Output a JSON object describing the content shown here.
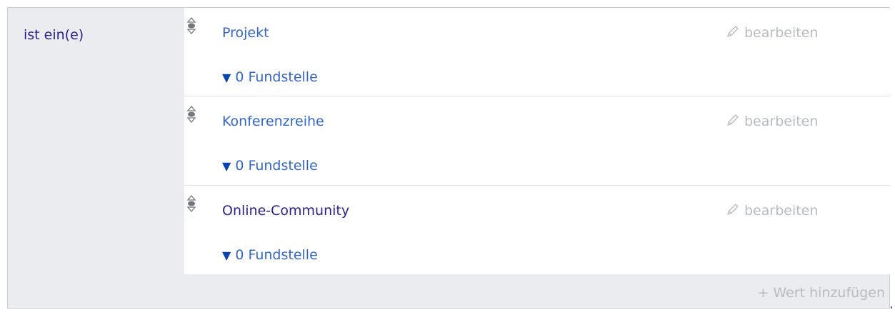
{
  "property": {
    "label": "ist ein(e)"
  },
  "statements": [
    {
      "value": "Projekt",
      "edit_label": "bearbeiten",
      "references_label": "0 Fundstelle",
      "references_toggle_glyph": "▼",
      "rank_icon": "normal-rank-icon"
    },
    {
      "value": "Konferenzreihe",
      "edit_label": "bearbeiten",
      "references_label": "0 Fundstelle",
      "references_toggle_glyph": "▼",
      "rank_icon": "normal-rank-icon"
    },
    {
      "value": "Online-Community",
      "edit_label": "bearbeiten",
      "references_label": "0 Fundstelle",
      "references_toggle_glyph": "▼",
      "rank_icon": "normal-rank-icon"
    }
  ],
  "add_value_label": "+ Wert hinzufügen",
  "colors": {
    "link": "#3366cc",
    "visited_link": "#2a1f8f",
    "disabled_text": "#b8bcc2",
    "group_background": "#eaecf0",
    "border": "#c8ccd1"
  }
}
